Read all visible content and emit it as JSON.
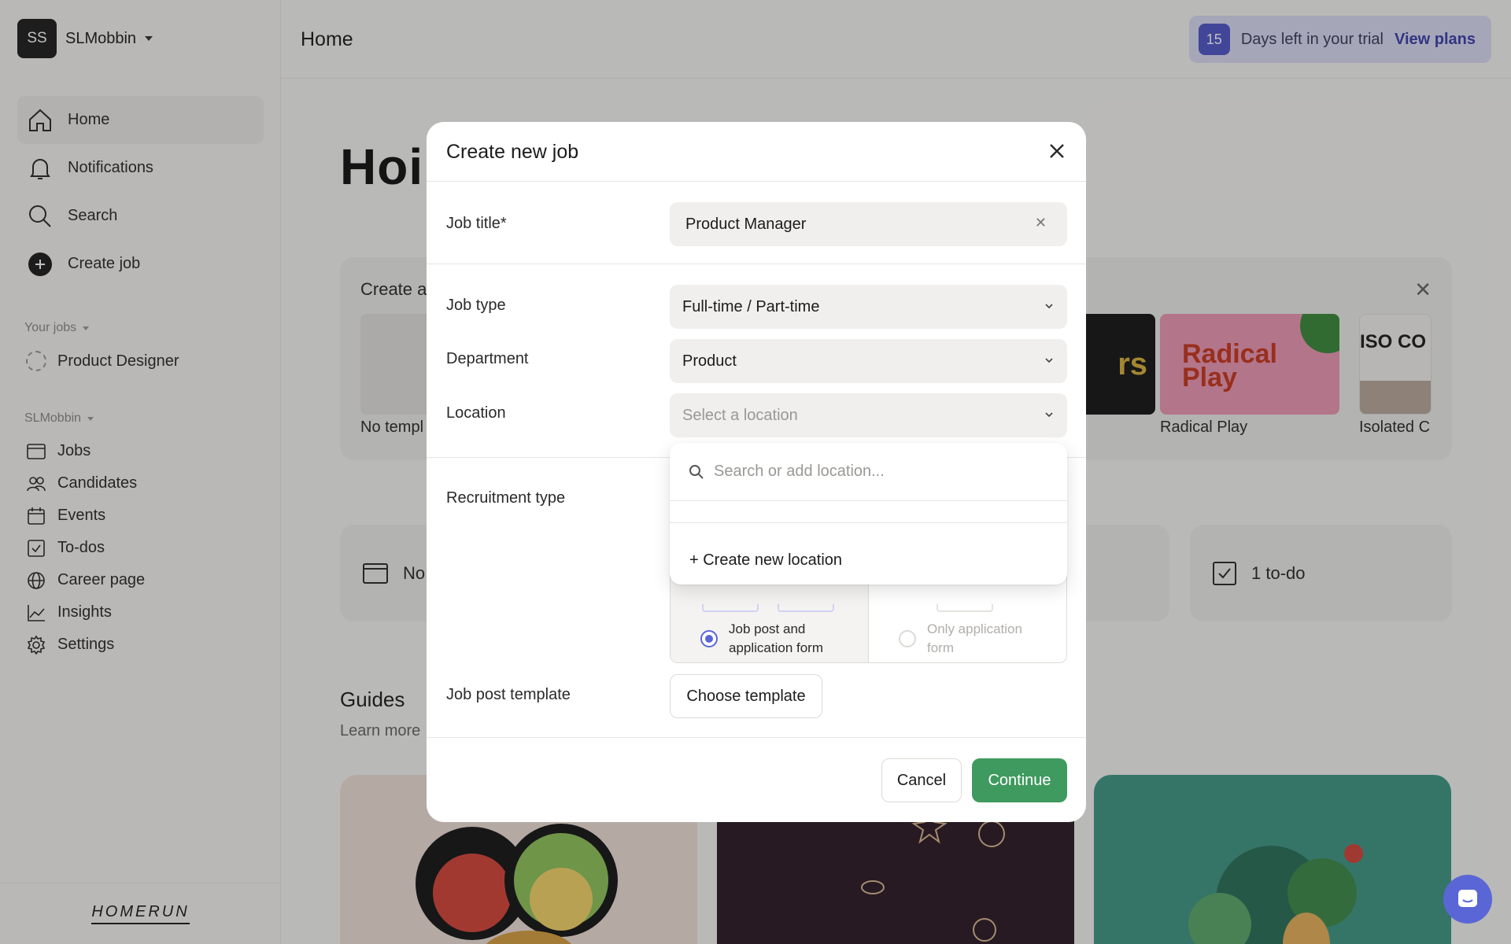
{
  "workspace": {
    "initials": "SS",
    "name": "SLMobbin"
  },
  "nav_top": [
    {
      "label": "Home",
      "icon": "home-icon"
    },
    {
      "label": "Notifications",
      "icon": "bell-icon"
    },
    {
      "label": "Search",
      "icon": "search-icon"
    },
    {
      "label": "Create job",
      "icon": "plus-circle-icon"
    }
  ],
  "your_jobs": {
    "label": "Your jobs",
    "job": "Product Designer"
  },
  "org_section": {
    "label": "SLMobbin"
  },
  "nav_list": [
    {
      "label": "Jobs",
      "icon": "jobs-icon"
    },
    {
      "label": "Candidates",
      "icon": "candidates-icon"
    },
    {
      "label": "Events",
      "icon": "calendar-icon"
    },
    {
      "label": "To-dos",
      "icon": "checkbox-icon"
    },
    {
      "label": "Career page",
      "icon": "globe-icon"
    },
    {
      "label": "Insights",
      "icon": "chart-icon"
    },
    {
      "label": "Settings",
      "icon": "gear-icon"
    }
  ],
  "logo": "HOMERUN",
  "header": {
    "title": "Home"
  },
  "trial": {
    "count": "15",
    "text": "Days left in your trial",
    "link": "View plans"
  },
  "main": {
    "big_title": "Hoi",
    "templates_card": {
      "title": "Create a",
      "items": [
        {
          "label": "No templ"
        },
        {
          "thumb_text": "rs"
        },
        {
          "label": "Radical Play",
          "thumb_text": "Radical Play"
        },
        {
          "label": "Isolated C",
          "thumb_text": "ISO CO"
        }
      ]
    },
    "small_cards": [
      {
        "label": "No"
      },
      {
        "label": "1 to-do"
      }
    ],
    "guides": {
      "title": "Guides",
      "subtitle": "Learn more"
    }
  },
  "modal": {
    "title": "Create new job",
    "job_title": {
      "label": "Job title*",
      "value": "Product Manager"
    },
    "job_type": {
      "label": "Job type",
      "value": "Full-time / Part-time"
    },
    "department": {
      "label": "Department",
      "value": "Product"
    },
    "location": {
      "label": "Location",
      "placeholder": "Select a location"
    },
    "location_dropdown": {
      "search_placeholder": "Search or add location...",
      "create_label": "+ Create new location"
    },
    "recruitment_type": {
      "label": "Recruitment type",
      "options": [
        {
          "label": "Job post and application form",
          "selected": true
        },
        {
          "label": "Only application form",
          "selected": false
        }
      ]
    },
    "job_post_template": {
      "label": "Job post template",
      "button": "Choose template"
    },
    "cancel": "Cancel",
    "continue": "Continue"
  },
  "colors": {
    "accent": "#5A66D6",
    "continue": "#3F9A5F",
    "trial_bg": "#DCDCF5"
  }
}
